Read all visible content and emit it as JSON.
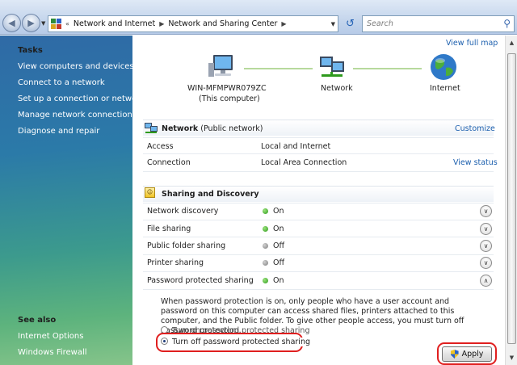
{
  "address": {
    "overflow": "«",
    "crumbs": [
      "Network and Internet",
      "Network and Sharing Center"
    ],
    "search_placeholder": "Search"
  },
  "sidebar": {
    "tasks_heading": "Tasks",
    "tasks": [
      "View computers and devices",
      "Connect to a network",
      "Set up a connection or network",
      "Manage network connections",
      "Diagnose and repair"
    ],
    "see_also_heading": "See also",
    "see_also": [
      "Internet Options",
      "Windows Firewall"
    ]
  },
  "map": {
    "view_full_map": "View full map",
    "computer_name": "WIN-MFMPWR079ZC",
    "computer_sub": "(This computer)",
    "network_label": "Network",
    "internet_label": "Internet"
  },
  "network": {
    "name": "Network",
    "type": "(Public network)",
    "customize": "Customize",
    "rows": [
      {
        "label": "Access",
        "value": "Local and Internet",
        "link": ""
      },
      {
        "label": "Connection",
        "value": "Local Area Connection",
        "link": "View status"
      }
    ]
  },
  "sharing": {
    "heading": "Sharing and Discovery",
    "rows": [
      {
        "label": "Network discovery",
        "status": "On"
      },
      {
        "label": "File sharing",
        "status": "On"
      },
      {
        "label": "Public folder sharing",
        "status": "Off"
      },
      {
        "label": "Printer sharing",
        "status": "Off"
      },
      {
        "label": "Password protected sharing",
        "status": "On"
      }
    ],
    "description": "When password protection is on, only people who have a user account and password on this computer can access shared files, printers attached to this computer, and the Public folder. To give other people access, you must turn off password protection.",
    "option_on": "Turn on password protected sharing",
    "option_off": "Turn off password protected sharing",
    "selected_option": "off",
    "apply_label": "Apply"
  },
  "colors": {
    "link": "#1c5fae",
    "highlight": "#e01f1f",
    "on": "#2e9a1d",
    "off": "#7d7d7d"
  }
}
